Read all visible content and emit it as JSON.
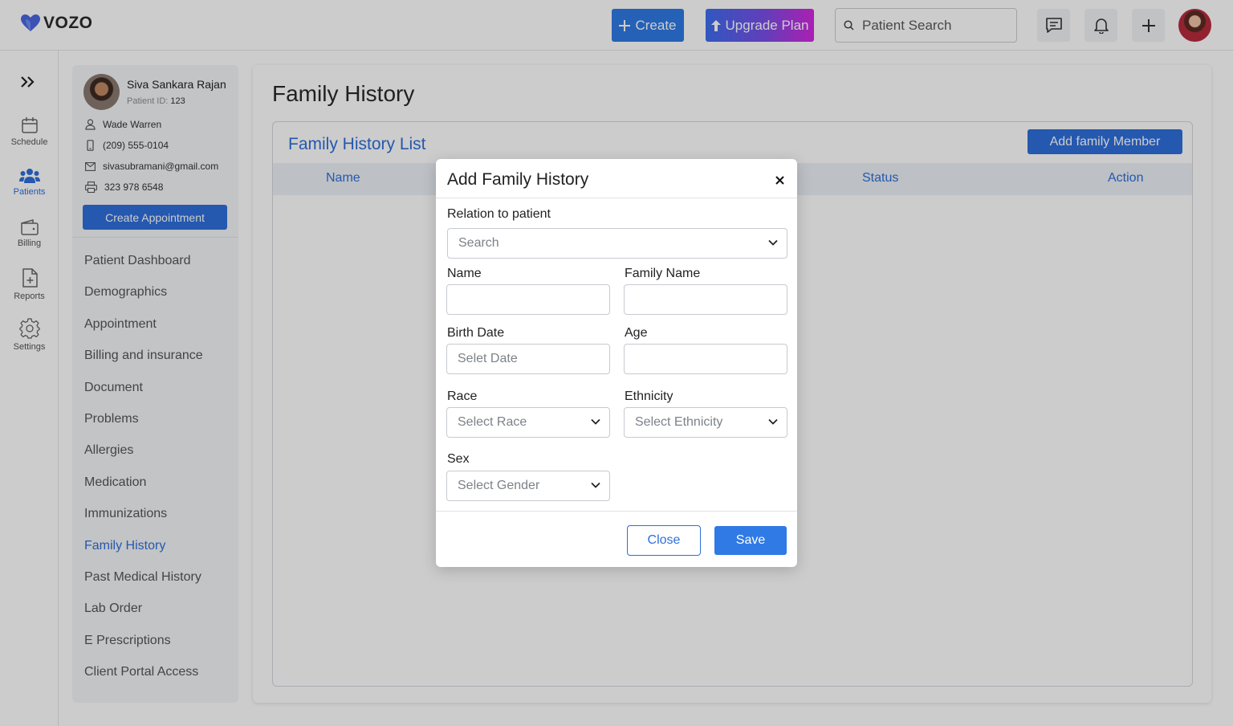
{
  "app": {
    "brand": "VOZO",
    "accent_color": "#2f6fdb"
  },
  "topbar": {
    "create_label": "Create",
    "upgrade_label": "Upgrade Plan",
    "search_placeholder": "Patient Search",
    "icons": [
      "chat-icon",
      "bell-icon",
      "plus-icon"
    ]
  },
  "rail": {
    "items": [
      {
        "label": "Schedule",
        "icon": "calendar-icon"
      },
      {
        "label": "Patients",
        "icon": "users-icon",
        "active": true
      },
      {
        "label": "Billing",
        "icon": "wallet-icon"
      },
      {
        "label": "Reports",
        "icon": "file-plus-icon"
      },
      {
        "label": "Settings",
        "icon": "gear-icon"
      }
    ]
  },
  "patient": {
    "name": "Siva Sankara Rajan",
    "id_label": "Patient ID:",
    "id_value": "123",
    "contact_name": "Wade Warren",
    "phone": "(209) 555-0104",
    "email": "sivasubramani@gmail.com",
    "fax": "323 978 6548",
    "appointment_button": "Create Appointment"
  },
  "nav": {
    "items": [
      "Patient Dashboard",
      "Demographics",
      "Appointment",
      "Billing and insurance",
      "Document",
      "Problems",
      "Allergies",
      "Medication",
      "Immunizations",
      "Family History",
      "Past Medical History",
      "Lab Order",
      "E Prescriptions",
      "Client Portal Access"
    ],
    "active": "Family History"
  },
  "main": {
    "title": "Family History",
    "list_title": "Family History List",
    "add_button": "Add family Member",
    "columns": [
      "Name",
      "Status",
      "Action"
    ]
  },
  "modal": {
    "title": "Add Family History",
    "relation_label": "Relation to patient",
    "relation_placeholder": "Search",
    "name_label": "Name",
    "name_value": "",
    "family_name_label": "Family Name",
    "family_name_value": "",
    "birth_date_label": "Birth Date",
    "birth_date_placeholder": "Selet Date",
    "age_label": "Age",
    "age_value": "",
    "race_label": "Race",
    "race_placeholder": "Select Race",
    "ethnicity_label": "Ethnicity",
    "ethnicity_placeholder": "Select Ethnicity",
    "sex_label": "Sex",
    "sex_placeholder": "Select Gender",
    "close_label": "Close",
    "save_label": "Save"
  }
}
